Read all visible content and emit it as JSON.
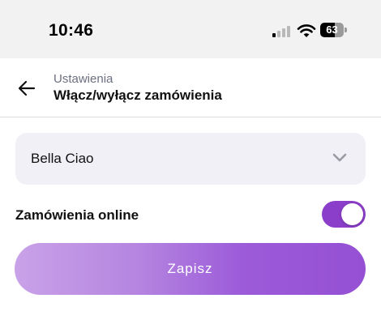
{
  "status_bar": {
    "time": "10:46",
    "battery_level": "63",
    "battery_fraction": 0.63,
    "icons": [
      "signal-icon",
      "wifi-icon",
      "battery-icon"
    ]
  },
  "header": {
    "breadcrumb": "Ustawienia",
    "title": "Włącz/wyłącz zamówienia",
    "back_icon": "arrow-left-icon"
  },
  "restaurant_select": {
    "value": "Bella Ciao",
    "icon": "chevron-down-icon"
  },
  "online_orders": {
    "label": "Zamówienia online",
    "enabled": true
  },
  "save_button": {
    "label": "Zapisz"
  },
  "colors": {
    "accent": "#8b3ec9",
    "field_background": "#f0f0f6",
    "button_gradient_start": "#c9a2e8",
    "button_gradient_end": "#9550d3",
    "breadcrumb_text": "#6b6f80"
  }
}
